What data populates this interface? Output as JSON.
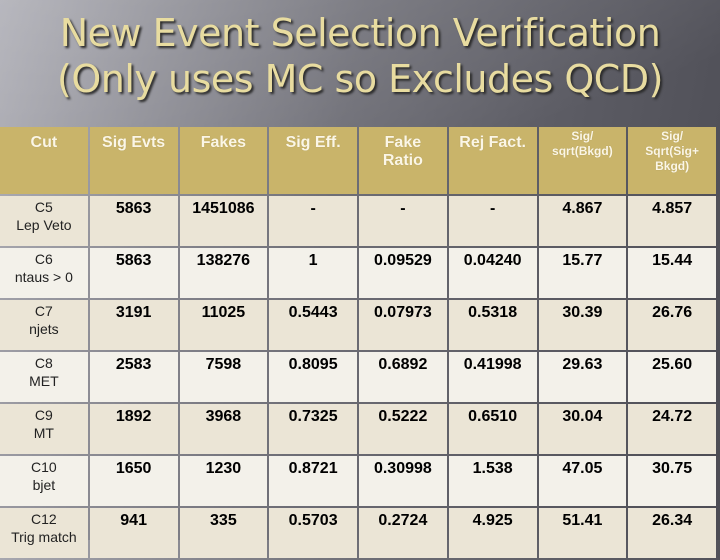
{
  "title": {
    "line1": "New Event Selection Verification",
    "line2": "(Only uses MC so Excludes QCD)"
  },
  "colors": {
    "title_text": "#e8dca0",
    "header_bg": "#c9b46a",
    "row_dark": "#ebe5d6",
    "row_light": "#f3f1ea"
  },
  "table": {
    "headers": [
      [
        "Cut"
      ],
      [
        "Sig Evts"
      ],
      [
        "Fakes"
      ],
      [
        "Sig Eff."
      ],
      [
        "Fake",
        "Ratio"
      ],
      [
        "Rej Fact."
      ],
      [
        "Sig/",
        "sqrt(Bkgd)"
      ],
      [
        "Sig/",
        "Sqrt(Sig+",
        "Bkgd)"
      ]
    ],
    "rows": [
      {
        "cut_id": "C5",
        "cut_name": "Lep Veto",
        "values": [
          "5863",
          "1451086",
          "-",
          "-",
          "-",
          "4.867",
          "4.857"
        ]
      },
      {
        "cut_id": "C6",
        "cut_name": "ntaus > 0",
        "values": [
          "5863",
          "138276",
          "1",
          "0.09529",
          "0.04240",
          "15.77",
          "15.44"
        ]
      },
      {
        "cut_id": "C7",
        "cut_name": "njets",
        "values": [
          "3191",
          "11025",
          "0.5443",
          "0.07973",
          "0.5318",
          "30.39",
          "26.76"
        ]
      },
      {
        "cut_id": "C8",
        "cut_name": "MET",
        "values": [
          "2583",
          "7598",
          "0.8095",
          "0.6892",
          "0.41998",
          "29.63",
          "25.60"
        ]
      },
      {
        "cut_id": "C9",
        "cut_name": "MT",
        "values": [
          "1892",
          "3968",
          "0.7325",
          "0.5222",
          "0.6510",
          "30.04",
          "24.72"
        ]
      },
      {
        "cut_id": "C10",
        "cut_name": "bjet",
        "values": [
          "1650",
          "1230",
          "0.8721",
          "0.30998",
          "1.538",
          "47.05",
          "30.75"
        ]
      },
      {
        "cut_id": "C12",
        "cut_name": "Trig match",
        "values": [
          "941",
          "335",
          "0.5703",
          "0.2724",
          "4.925",
          "51.41",
          "26.34"
        ]
      }
    ]
  }
}
